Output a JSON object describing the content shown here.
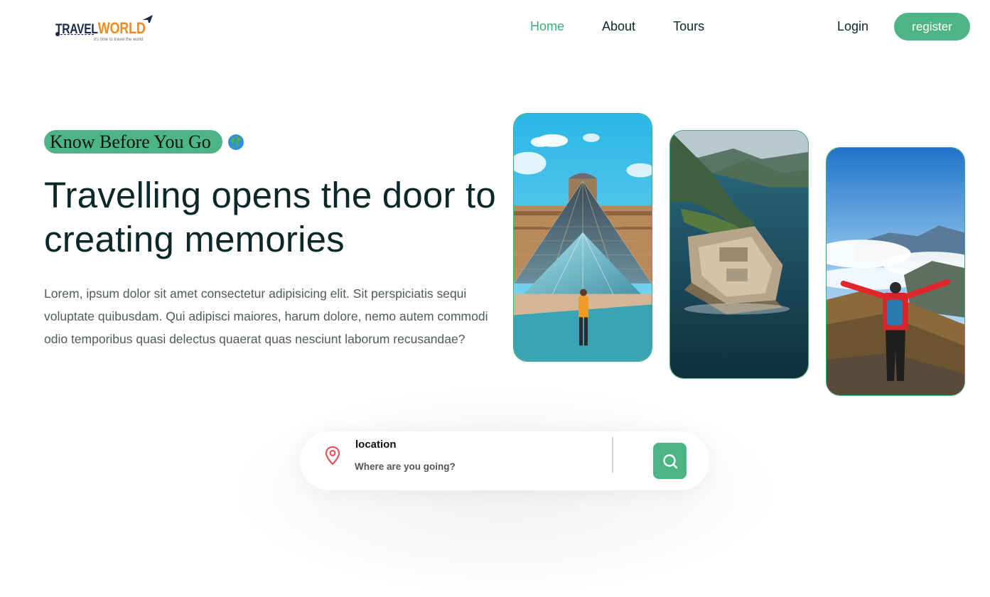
{
  "header": {
    "logo": {
      "brand_part1": "TRAVEL",
      "brand_part2": "WORLD",
      "tagline": "it's time to travel the world"
    },
    "nav": [
      {
        "label": "Home",
        "active": true
      },
      {
        "label": "About",
        "active": false
      },
      {
        "label": "Tours",
        "active": false
      }
    ],
    "login_label": "Login",
    "register_label": "register"
  },
  "hero": {
    "badge": "Know Before You Go",
    "badge_icon": "globe-icon",
    "title": "Travelling opens the door to creating memories",
    "description": "Lorem, ipsum dolor sit amet consectetur adipisicing elit. Sit perspiciatis sequi voluptate quibusdam. Qui adipisci maiores, harum dolore, nemo autem commodi odio temporibus quasi delectus quaerat quas nesciunt laborum recusandae?",
    "images": [
      "louvre-pyramid-photo",
      "coastal-fortress-photo",
      "mountain-hiker-photo"
    ]
  },
  "search": {
    "label": "location",
    "placeholder": "Where are you going?",
    "pin_icon": "map-pin-icon",
    "button_icon": "search-icon"
  },
  "colors": {
    "primary": "#4db585",
    "heading": "#0b2727",
    "logo_navy": "#1b2a4a",
    "logo_orange": "#f08a24",
    "pin": "#e4555a"
  }
}
